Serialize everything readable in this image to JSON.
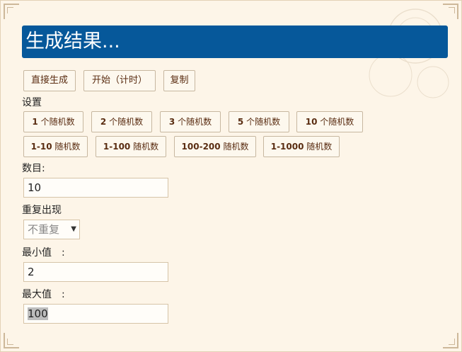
{
  "banner": {
    "title": "生成结果..."
  },
  "actions": {
    "direct": "直接生成",
    "start": "开始（计时）",
    "copy": "复制"
  },
  "settings": {
    "heading": "设置",
    "presets_row1": [
      {
        "num": "1",
        "text": " 个随机数"
      },
      {
        "num": "2",
        "text": " 个随机数"
      },
      {
        "num": "3",
        "text": " 个随机数"
      },
      {
        "num": "5",
        "text": " 个随机数"
      },
      {
        "num": "10",
        "text": " 个随机数"
      }
    ],
    "presets_row2": [
      {
        "num": "1-10",
        "text": " 随机数"
      },
      {
        "num": "1-100",
        "text": " 随机数"
      },
      {
        "num": "100-200",
        "text": " 随机数"
      },
      {
        "num": "1-1000",
        "text": " 随机数"
      }
    ]
  },
  "form": {
    "count_label": "数目:",
    "count_value": "10",
    "repeat_label": "重复出现",
    "repeat_selected": "不重复",
    "min_label": "最小值　:",
    "min_value": "2",
    "max_label": "最大值　:",
    "max_value": "100"
  },
  "icons": {
    "select_arrow": "chevron-down-icon"
  }
}
